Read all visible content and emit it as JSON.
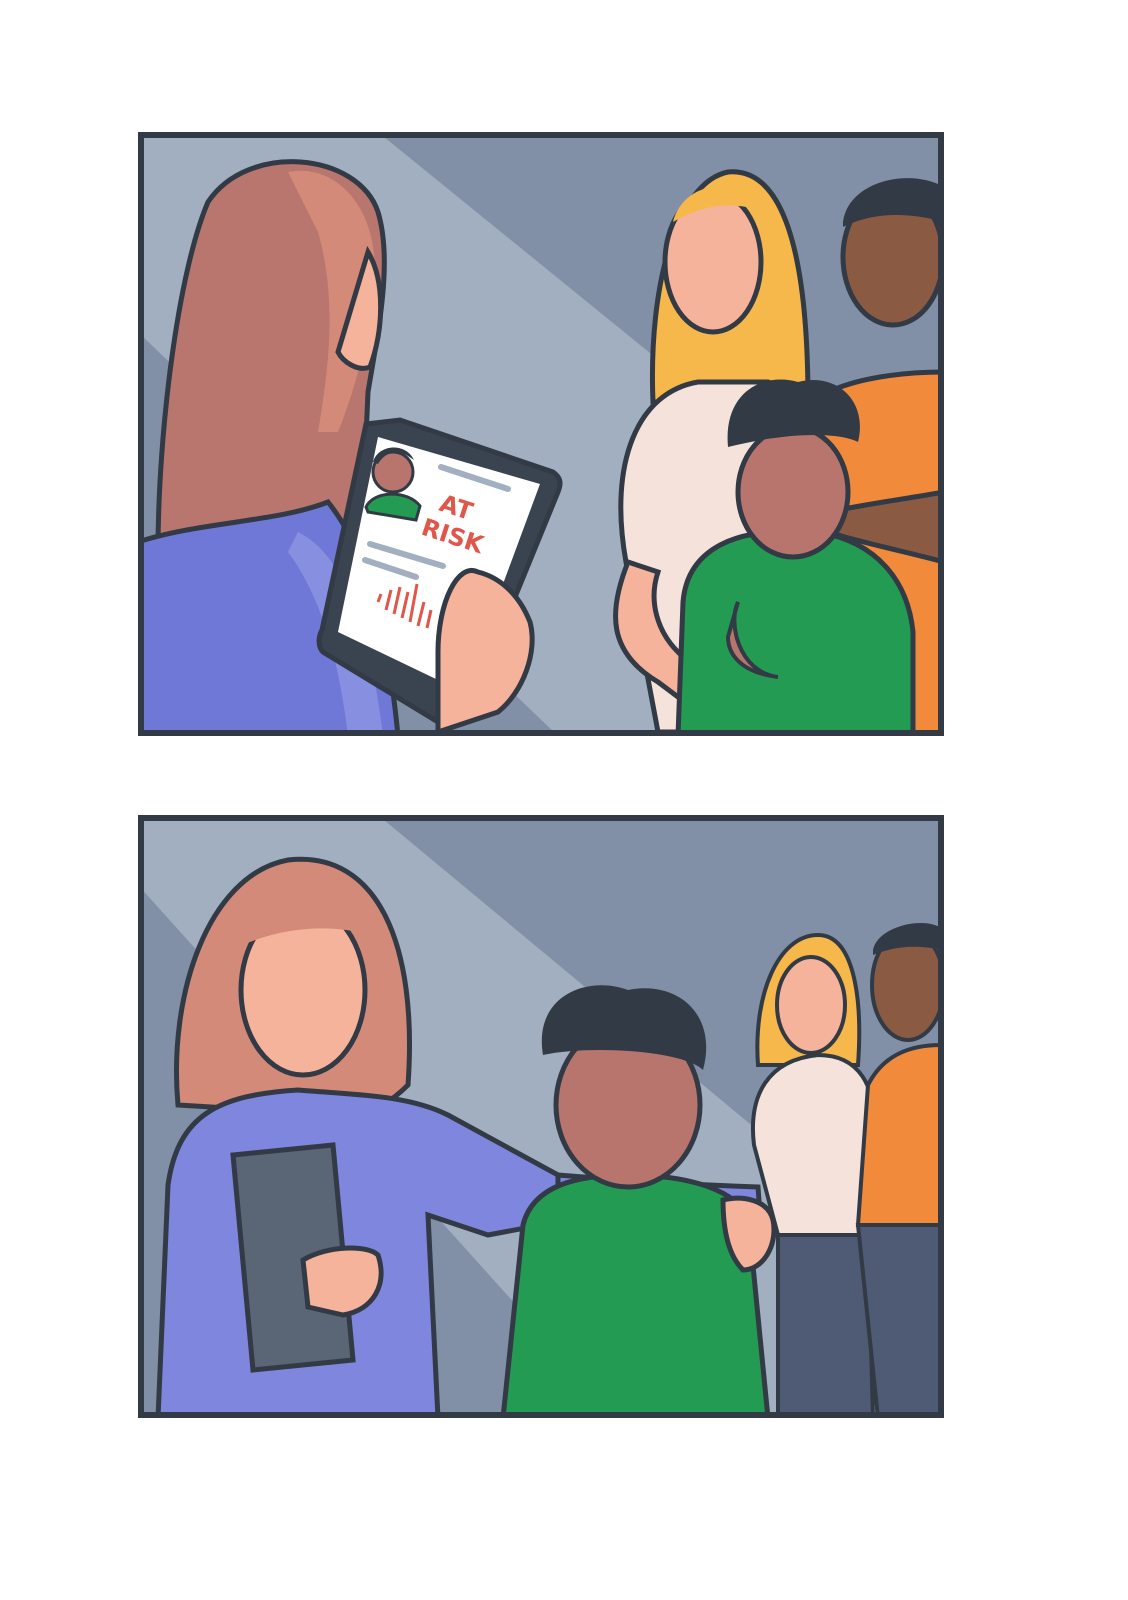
{
  "comic": {
    "panels": [
      {
        "tablet_label_line1": "AT",
        "tablet_label_line2": "RISK"
      },
      {}
    ]
  },
  "colors": {
    "page_background": "#ffffff",
    "panel_border": "#323a45",
    "wall_light": "#a1afc1",
    "wall_dark": "#8190a6",
    "cardigan_blue": "#6f78d6",
    "hair_auburn": "#d48a78",
    "hair_blonde": "#f6b84a",
    "hoodie_green": "#249b52",
    "shirt_orange": "#f28a3c",
    "alert_red": "#e0574a"
  },
  "icons": [
    "profile-avatar-icon",
    "bar-sparkline-icon"
  ]
}
